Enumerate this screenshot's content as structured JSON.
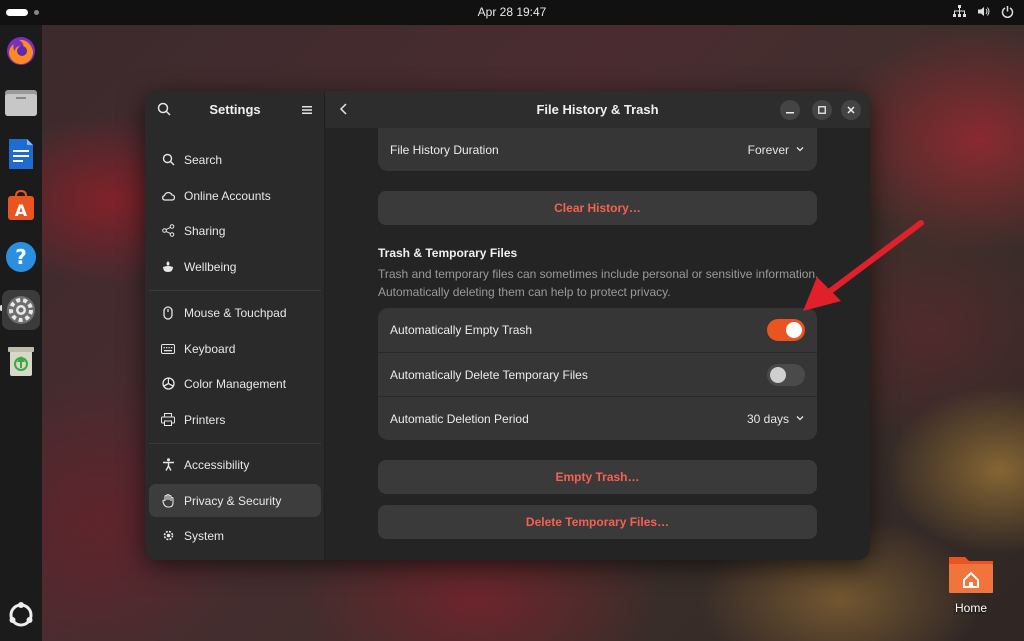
{
  "topbar": {
    "clock": "Apr 28  19:47"
  },
  "dock": {
    "items": [
      "firefox-icon",
      "files-icon",
      "writer-icon",
      "app-center-icon",
      "help-icon",
      "settings-icon",
      "trash-icon",
      "show-apps-icon"
    ]
  },
  "settings": {
    "sidebar_title": "Settings",
    "items": [
      {
        "label": "Search",
        "icon": "search-icon"
      },
      {
        "label": "Online Accounts",
        "icon": "cloud-icon"
      },
      {
        "label": "Sharing",
        "icon": "share-icon"
      },
      {
        "label": "Wellbeing",
        "icon": "wellbeing-icon"
      },
      {
        "label": "Mouse & Touchpad",
        "icon": "mouse-icon"
      },
      {
        "label": "Keyboard",
        "icon": "keyboard-icon"
      },
      {
        "label": "Color Management",
        "icon": "color-icon"
      },
      {
        "label": "Printers",
        "icon": "printer-icon"
      },
      {
        "label": "Accessibility",
        "icon": "accessibility-icon"
      },
      {
        "label": "Privacy & Security",
        "icon": "hand-icon"
      },
      {
        "label": "System",
        "icon": "system-icon"
      }
    ]
  },
  "page": {
    "title": "File History & Trash",
    "file_history_duration_label": "File History Duration",
    "file_history_duration_value": "Forever",
    "clear_history_label": "Clear History…",
    "section_title": "Trash & Temporary Files",
    "section_desc_line1": "Trash and temporary files can sometimes include personal or sensitive information.",
    "section_desc_line2": "Automatically deleting them can help to protect privacy.",
    "auto_empty_trash_label": "Automatically Empty Trash",
    "auto_empty_trash_on": true,
    "auto_delete_temp_label": "Automatically Delete Temporary Files",
    "auto_delete_temp_on": false,
    "deletion_period_label": "Automatic Deletion Period",
    "deletion_period_value": "30 days",
    "empty_trash_label": "Empty Trash…",
    "delete_temp_label": "Delete Temporary Files…"
  },
  "desktop": {
    "home_label": "Home"
  },
  "colors": {
    "accent": "#e95420",
    "destructive": "#f66151",
    "annotation_arrow": "#e0202a"
  }
}
